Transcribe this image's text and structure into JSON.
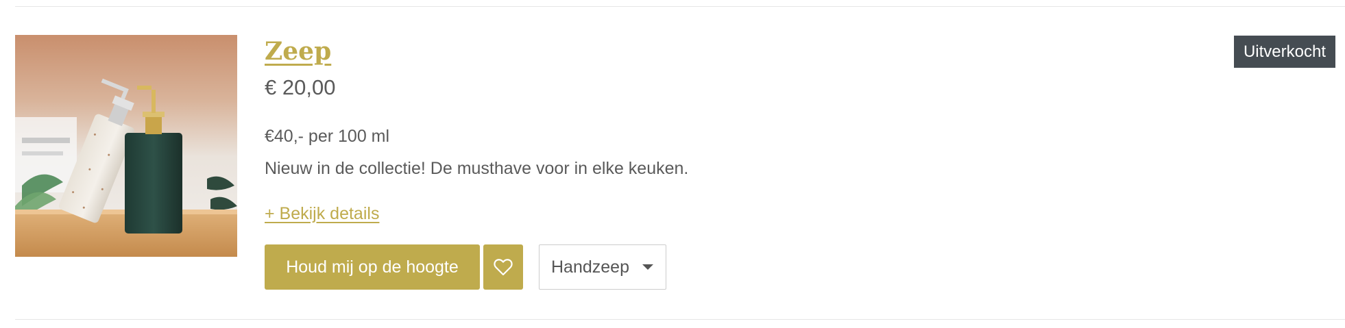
{
  "product": {
    "title": "Zeep",
    "price": "€ 20,00",
    "unit_price": "€40,- per 100 ml",
    "description": "Nieuw in de collectie! De musthave voor in elke keuken.",
    "details_link": "+ Bekijk details",
    "badge": "Uitverkocht",
    "image_alt": "Zeepdispensers"
  },
  "actions": {
    "notify_label": "Houd mij op de hoogte",
    "wishlist_icon": "heart-icon",
    "variant_selected": "Handzeep"
  },
  "colors": {
    "accent": "#bfab4d",
    "badge_bg": "#454c52",
    "text": "#5a5a5a",
    "divider": "#e6e6e6"
  }
}
